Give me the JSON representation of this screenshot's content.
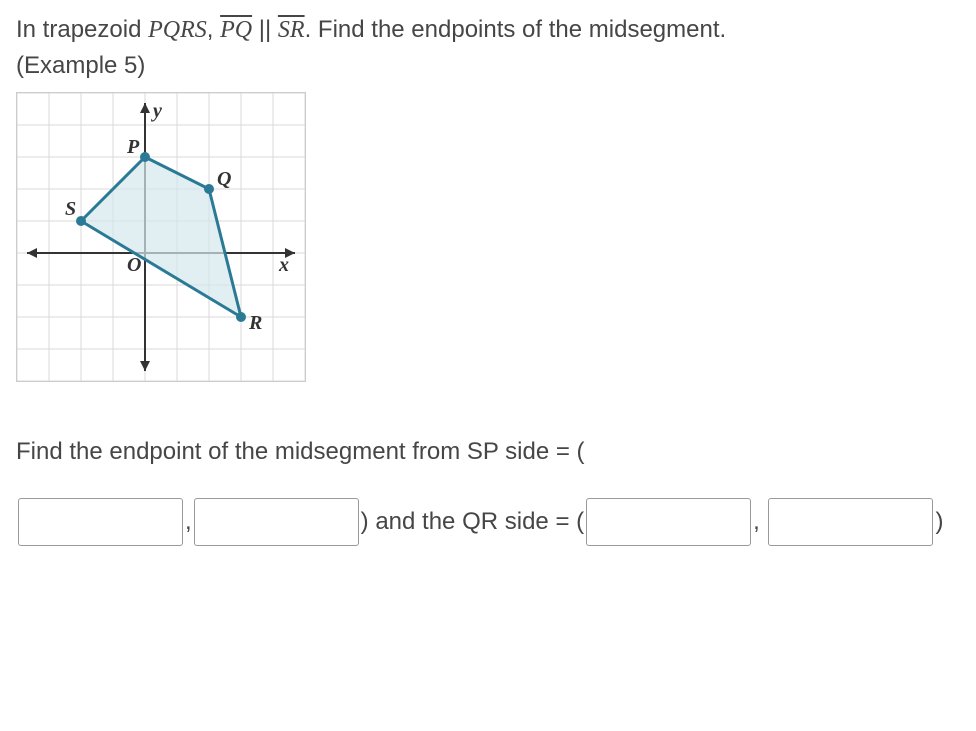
{
  "problem": {
    "line1_prefix": "In trapezoid ",
    "shape_name": "PQRS",
    "comma": ", ",
    "seg1": "PQ",
    "parallel": " || ",
    "seg2": "SR",
    "line1_suffix": ". Find the endpoints of the midsegment.",
    "line2": "(Example 5)"
  },
  "graph": {
    "labels": {
      "y": "y",
      "x": "x",
      "P": "P",
      "Q": "Q",
      "R": "R",
      "S": "S",
      "O": "O"
    }
  },
  "answer": {
    "prompt_prefix": "Find the endpoint of the midsegment from SP side = (",
    "mid_text": ") and the QR side = (",
    "close_text": ")",
    "comma": ","
  }
}
